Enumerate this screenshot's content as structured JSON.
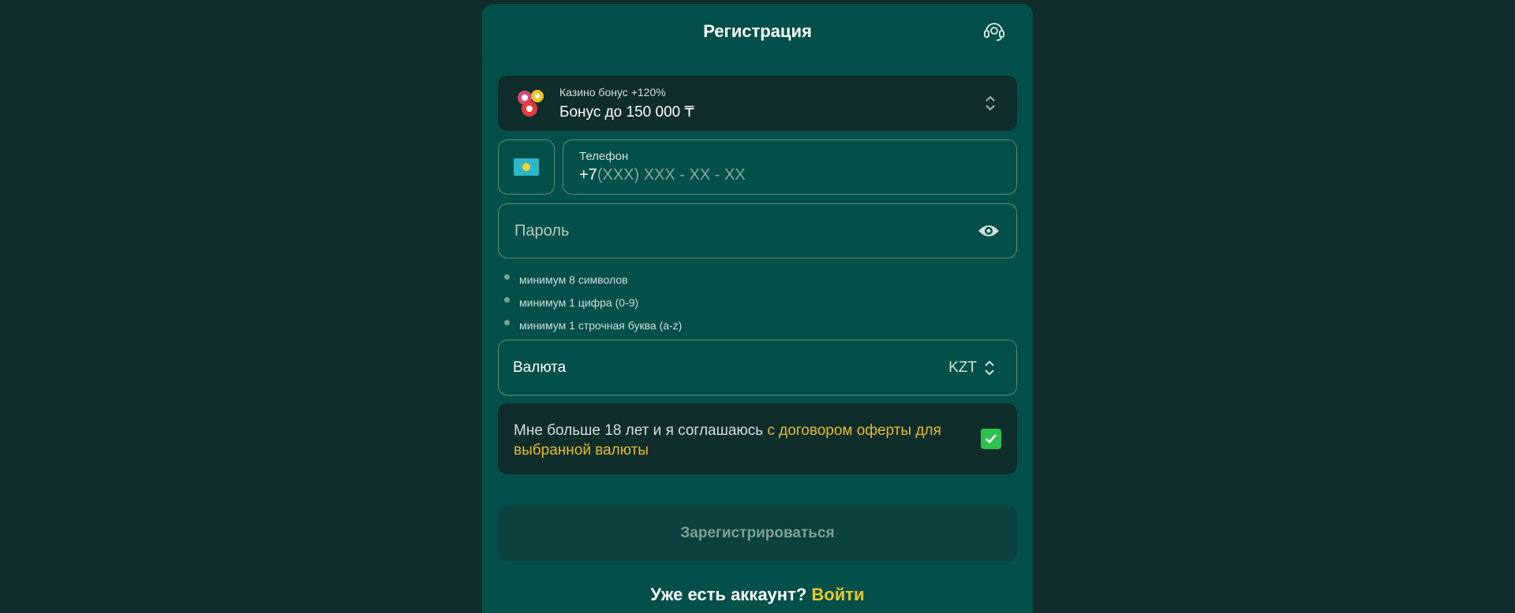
{
  "header": {
    "title": "Регистрация",
    "support_icon": "headset-icon"
  },
  "bonus": {
    "subtitle": "Казино бонус +120%",
    "title": "Бонус до 150 000 ₸",
    "icon": "casino-chips-icon"
  },
  "phone": {
    "label": "Телефон",
    "code": "+7",
    "mask": "(XXX) XXX - XX - XX",
    "flag": "kazakhstan-flag"
  },
  "password": {
    "placeholder": "Пароль",
    "icon": "eye-icon"
  },
  "rules": [
    "минимум 8 символов",
    "минимум 1 цифра (0-9)",
    "минимум 1 строчная буква (a-z)"
  ],
  "currency": {
    "label": "Валюта",
    "value": "KZT"
  },
  "agreement": {
    "text": "Мне больше 18 лет и я соглашаюсь ",
    "link": "с договором оферты для выбранной валюты",
    "checked": true
  },
  "register": {
    "label": "Зарегистрироваться"
  },
  "login": {
    "question": "Уже есть аккаунт?",
    "link": "Войти"
  },
  "colors": {
    "background": "#0f2e2b",
    "panel": "#03504a",
    "accent": "#e8c72c",
    "check": "#2ec24d"
  }
}
